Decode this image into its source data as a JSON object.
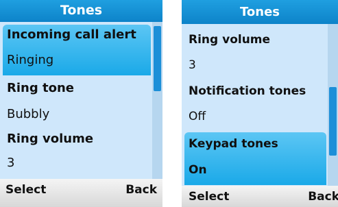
{
  "screens": [
    {
      "title": "Tones",
      "items": [
        {
          "label": "Incoming call alert",
          "value": "Ringing"
        },
        {
          "label": "Ring tone",
          "value": "Bubbly"
        },
        {
          "label": "Ring volume",
          "value": "3"
        }
      ],
      "softkeys": {
        "left": "Select",
        "right": "Back"
      }
    },
    {
      "title": "Tones",
      "items": [
        {
          "label": "Ring volume",
          "value": "3"
        },
        {
          "label": "Notification tones",
          "value": "Off"
        },
        {
          "label": "Keypad tones",
          "value": "On"
        }
      ],
      "softkeys": {
        "left": "Select",
        "right": "Back"
      }
    }
  ]
}
